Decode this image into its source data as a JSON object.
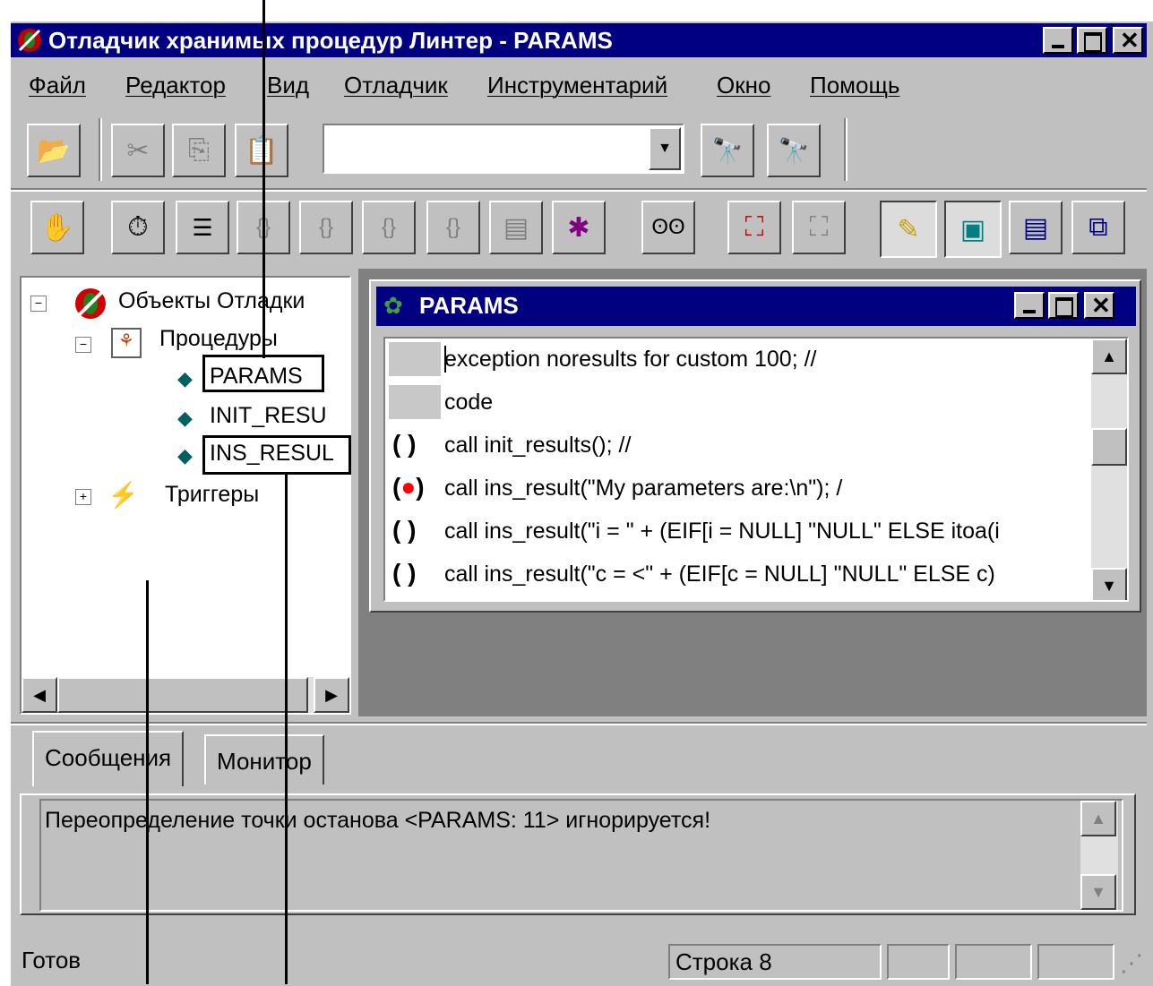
{
  "window": {
    "title": "Отладчик хранимых процедур Линтер - PARAMS"
  },
  "menu": [
    "Файл",
    "Редактор",
    "Вид",
    "Отладчик",
    "Инструментарий",
    "Окно",
    "Помощь"
  ],
  "toolbar": {
    "search_value": ""
  },
  "tree": {
    "root": "Объекты Отладки",
    "procedures_label": "Процедуры",
    "procedures": [
      "PARAMS",
      "INIT_RESU",
      "INS_RESUL"
    ],
    "triggers_label": "Триггеры"
  },
  "editor": {
    "title": "PARAMS",
    "lines": [
      {
        "marker": "",
        "text": "exception noresults for custom 100; //"
      },
      {
        "marker": "",
        "text": "code"
      },
      {
        "marker": "( )",
        "text": "call init_results();                              //"
      },
      {
        "marker": "(•)",
        "text": "call ins_result(\"My parameters are:\\n\");                    /"
      },
      {
        "marker": "( )",
        "text": "call ins_result(\"i = \" + (EIF[i = NULL] \"NULL\" ELSE itoa(i"
      },
      {
        "marker": "( )",
        "text": "call ins_result(\"c = <\" + (EIF[c = NULL] \"NULL\" ELSE c)"
      }
    ]
  },
  "tabs": [
    "Сообщения",
    "Монитор"
  ],
  "messages": {
    "text": "Переопределение точки останова <PARAMS: 11> игнорируется!"
  },
  "status": {
    "ready": "Готов",
    "position": "Строка 8"
  }
}
